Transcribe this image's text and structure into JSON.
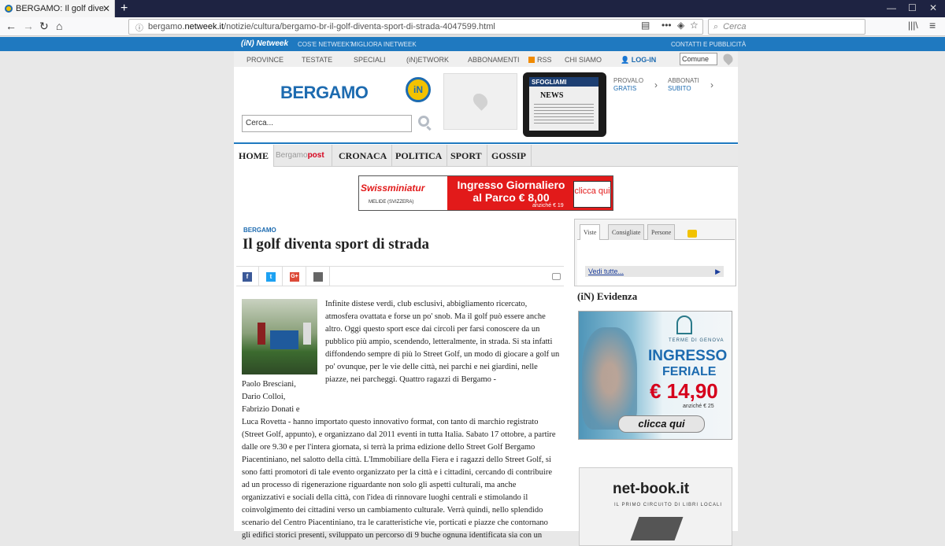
{
  "browser": {
    "tab_title": "BERGAMO: Il golf diventa sport di strada",
    "url_prefix": "bergamo.",
    "url_host": "netweek.it",
    "url_path": "/notizie/cultura/bergamo-br-il-golf-diventa-sport-di-strada-4047599.html",
    "search_placeholder": "Cerca"
  },
  "netweek_bar": {
    "logo": "(iN) Netweek",
    "links": [
      "COS'E NETWEEK?",
      "MIGLIORA INETWEEK",
      "CONTATTI E PUBBLICITÀ"
    ]
  },
  "topnav": {
    "items": [
      "PROVINCE",
      "TESTATE",
      "SPECIALI",
      "(iN)ETWORK",
      "ABBONAMENTI",
      "RSS",
      "CHI SIAMO",
      "LOG-IN"
    ],
    "comune_value": "Comune"
  },
  "header": {
    "logo": "BERGAMO",
    "badge": "iN",
    "search_placeholder": "Cerca...",
    "tablet_label": "SFOGLIAMI",
    "tablet_news": "NEWS",
    "promo1_line1": "PROVALO",
    "promo1_line2": "GRATIS",
    "promo2_line1": "ABBONATI",
    "promo2_line2": "SUBITO"
  },
  "mainnav": {
    "home": "HOME",
    "bergamopost_a": "Bergamo",
    "bergamopost_b": "post",
    "items": [
      "CRONACA",
      "POLITICA",
      "SPORT",
      "GOSSIP"
    ]
  },
  "banner": {
    "brand": "Swissminiatur",
    "brand_sub": "MELIDE (SVIZZERA)",
    "headline": "Ingresso Giornaliero al Parco € 8,00",
    "anziche": "anziché € 19",
    "cta": "clicca qui"
  },
  "article": {
    "kicker": "BERGAMO",
    "title": "Il golf diventa sport di strada",
    "p1": "Infinite distese verdi, club esclusivi, abbigliamento ricercato, atmosfera ovattata e forse un po' snob. Ma il golf può essere anche altro. Oggi questo sport esce dai circoli per farsi conoscere da un pubblico più ampio, scendendo, letteralmente, in strada. Si sta infatti diffondendo sempre di più lo Street Golf, un modo di giocare a golf un po' ovunque, per le vie delle città, nei parchi e nei giardini, nelle piazze, nei parcheggi. Quattro ragazzi di Bergamo -",
    "names": [
      "Paolo Bresciani,",
      "Dario Colloi,",
      "Fabrizio Donati e"
    ],
    "p2": "Luca Rovetta - hanno importato questo innovativo format, con tanto di marchio registrato (Street Golf, appunto), e organizzano dal 2011 eventi in tutta Italia. Sabato 17 ottobre, a partire dalle ore 9.30 e per l'intera giornata, si terrà la prima edizione dello Street Golf Bergamo Piacentiniano, nel salotto della città. L'Immobiliare della Fiera e i ragazzi dello Street Golf, si sono fatti promotori di tale evento organizzato per la città e i cittadini, cercando di contribuire ad un processo di rigenerazione riguardante non solo gli aspetti culturali, ma anche organizzativi e sociali della città, con l'idea di rinnovare luoghi centrali e stimolando il coinvolgimento dei cittadini verso un cambiamento culturale. Verrà quindi, nello splendido scenario del Centro Piacentiniano, tra le caratteristiche vie, porticati e piazze che contornano gli edifici storici presenti, sviluppato un percorso di 9 buche ognuna identificata sia con un"
  },
  "share": {
    "facebook": "f",
    "twitter": "t",
    "gplus": "G+"
  },
  "sidebar": {
    "tabs": [
      "Viste",
      "Consigliate",
      "Persone"
    ],
    "vedi_tutte": "Vedi tutte...",
    "evidenza_title": "(iN) Evidenza",
    "terme": {
      "brand": "TERME DI GENOVA",
      "line1": "INGRESSO",
      "line2": "FERIALE",
      "price": "€ 14,90",
      "anziche": "anziché € 25",
      "cta": "clicca qui"
    },
    "netbook": {
      "title": "net-book.it",
      "subtitle": "IL PRIMO CIRCUITO DI LIBRI LOCALI"
    }
  }
}
